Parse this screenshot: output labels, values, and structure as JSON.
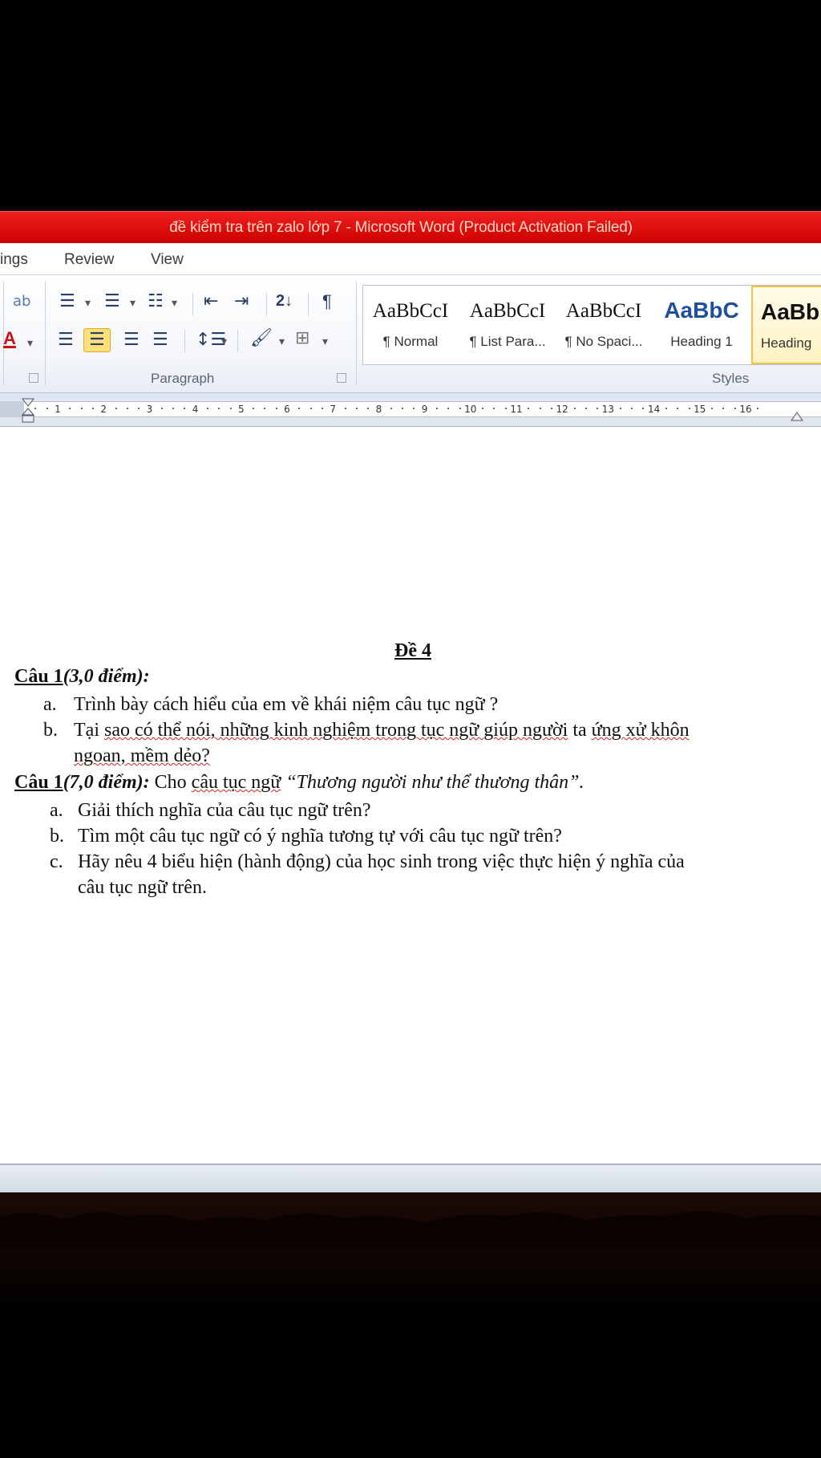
{
  "window": {
    "title": "đề kiểm tra trên zalo lớp 7 -  Microsoft Word (Product Activation Failed)"
  },
  "tabs": [
    "ings",
    "Review",
    "View"
  ],
  "ribbon": {
    "paragraph_label": "Paragraph",
    "styles_label": "Styles",
    "styles": [
      {
        "sample": "AaBbCcI",
        "name": "¶ Normal"
      },
      {
        "sample": "AaBbCcI",
        "name": "¶ List Para..."
      },
      {
        "sample": "AaBbCcI",
        "name": "¶ No Spaci..."
      },
      {
        "sample": "AaBbC",
        "name": "Heading 1"
      },
      {
        "sample": "AaBb",
        "name": "Heading"
      }
    ],
    "font_color_glyph": "A",
    "pilcrow": "¶",
    "sort_glyph": "2↓"
  },
  "ruler": {
    "numbers": [
      "1",
      "2",
      "3",
      "4",
      "5",
      "6",
      "7",
      "8",
      "9",
      "10",
      "11",
      "12",
      "13",
      "14",
      "15",
      "16"
    ]
  },
  "document": {
    "heading": "Đề 4",
    "q1": {
      "label": "Câu 1",
      "points": "(3,0 điểm):",
      "a_marker": "a.",
      "a_text": "Trình bày cách hiểu của em về khái niệm câu tục ngữ ?",
      "b_marker": "b.",
      "b_pre": "Tại ",
      "b_sq1": "sao có thể nói, những kinh nghiệm trong tục ngữ giúp người",
      "b_mid": " ta ",
      "b_sq2": "ứng xử khôn",
      "b_line2": "ngoan, mềm dẻo?"
    },
    "q2": {
      "label": "Câu 1",
      "points": "(7,0 điểm):",
      "lead": " Cho ",
      "lead_sq": "câu tục ngữ",
      "quote": " “Thương người như thể thương thân”.",
      "a_marker": "a.",
      "a_text": "Giải thích nghĩa của câu tục ngữ  trên?",
      "b_marker": "b.",
      "b_text": "Tìm một câu tục ngữ có ý nghĩa tương tự với câu tục ngữ trên?",
      "c_marker": "c.",
      "c_text": "Hãy nêu 4 biểu hiện (hành động) của học sinh trong việc thực hiện ý nghĩa của",
      "c_line2": "câu tục ngữ trên."
    }
  }
}
